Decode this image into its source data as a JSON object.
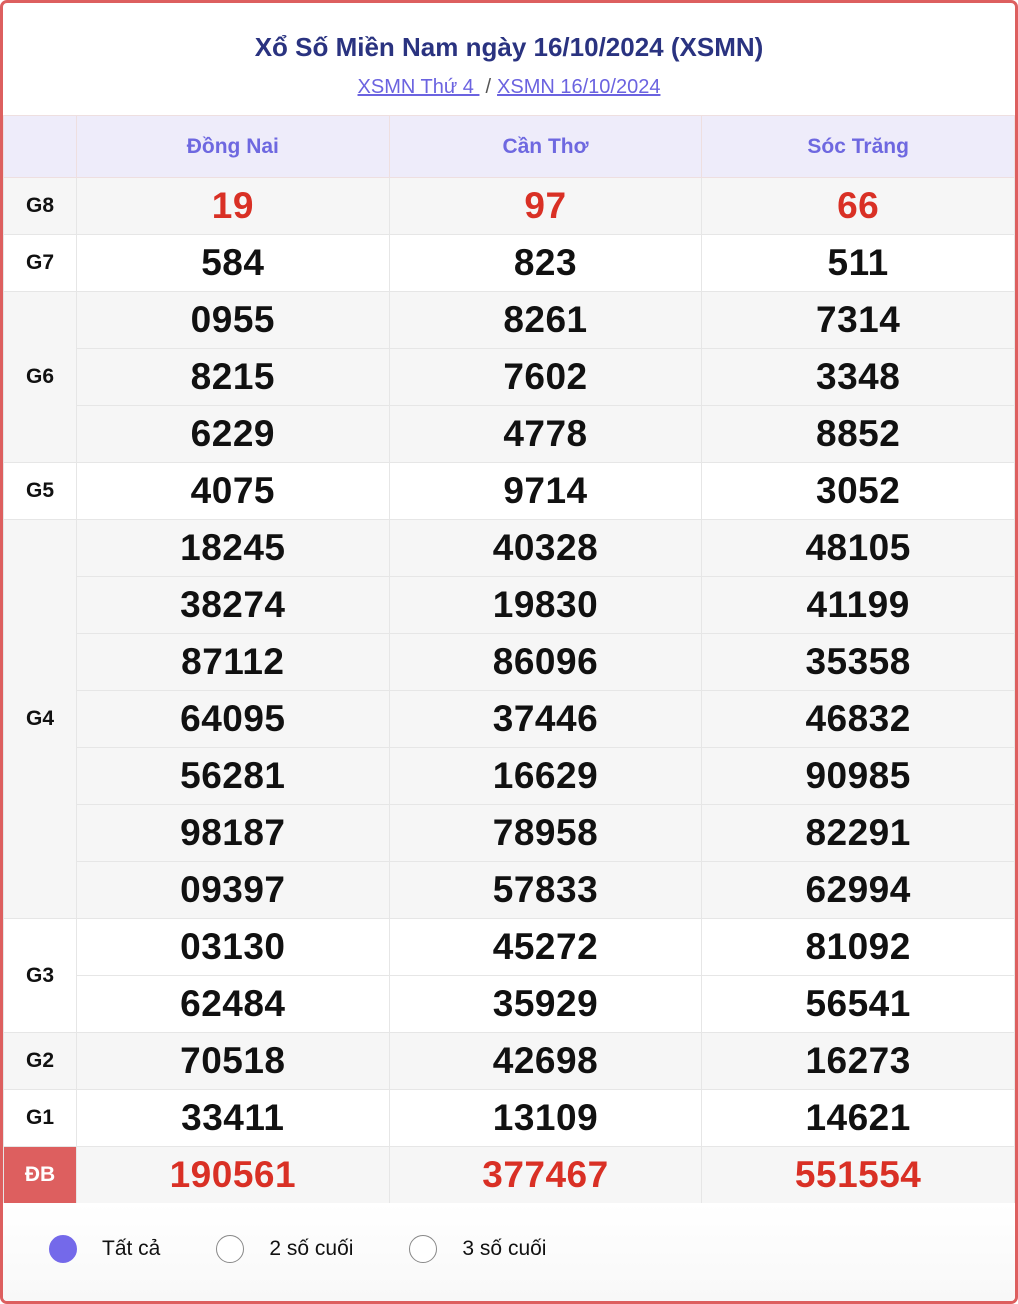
{
  "header": {
    "title": "Xổ Số Miền Nam ngày 16/10/2024 (XSMN)",
    "breadcrumbs": [
      {
        "label": "XSMN Thứ 4 "
      },
      {
        "label": "XSMN 16/10/2024"
      }
    ],
    "separator": "/"
  },
  "table": {
    "provinces": [
      "Đồng Nai",
      "Cần Thơ",
      "Sóc Trăng"
    ],
    "prizes": [
      {
        "label": "G8",
        "highlight": true,
        "rows": [
          [
            "19",
            "97",
            "66"
          ]
        ]
      },
      {
        "label": "G7",
        "rows": [
          [
            "584",
            "823",
            "511"
          ]
        ]
      },
      {
        "label": "G6",
        "rows": [
          [
            "0955",
            "8261",
            "7314"
          ],
          [
            "8215",
            "7602",
            "3348"
          ],
          [
            "6229",
            "4778",
            "8852"
          ]
        ]
      },
      {
        "label": "G5",
        "rows": [
          [
            "4075",
            "9714",
            "3052"
          ]
        ]
      },
      {
        "label": "G4",
        "rows": [
          [
            "18245",
            "40328",
            "48105"
          ],
          [
            "38274",
            "19830",
            "41199"
          ],
          [
            "87112",
            "86096",
            "35358"
          ],
          [
            "64095",
            "37446",
            "46832"
          ],
          [
            "56281",
            "16629",
            "90985"
          ],
          [
            "98187",
            "78958",
            "82291"
          ],
          [
            "09397",
            "57833",
            "62994"
          ]
        ]
      },
      {
        "label": "G3",
        "rows": [
          [
            "03130",
            "45272",
            "81092"
          ],
          [
            "62484",
            "35929",
            "56541"
          ]
        ]
      },
      {
        "label": "G2",
        "rows": [
          [
            "70518",
            "42698",
            "16273"
          ]
        ]
      },
      {
        "label": "G1",
        "rows": [
          [
            "33411",
            "13109",
            "14621"
          ]
        ]
      },
      {
        "label": "ĐB",
        "highlight": true,
        "special": true,
        "rows": [
          [
            "190561",
            "377467",
            "551554"
          ]
        ]
      }
    ]
  },
  "filter": {
    "options": [
      {
        "label": "Tất cả",
        "selected": true
      },
      {
        "label": "2 số cuối",
        "selected": false
      },
      {
        "label": "3 số cuối",
        "selected": false
      }
    ]
  },
  "colors": {
    "border": "#dd5f5f",
    "title": "#2a3380",
    "link": "#6b63e0",
    "header_text": "#6e68e0",
    "highlight": "#d93025",
    "radio_selected": "#7469ea"
  }
}
